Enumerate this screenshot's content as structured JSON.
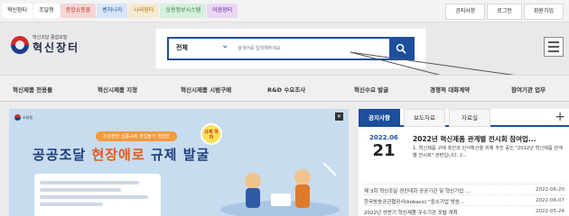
{
  "top_links": [
    {
      "label": "혁신장터",
      "bg": "#ffffff",
      "fg": "#222222"
    },
    {
      "label": "조달청",
      "bg": "#ffffff",
      "fg": "#222222"
    },
    {
      "label": "종합쇼핑몰",
      "bg": "#f4d6d6",
      "fg": "#c0392b"
    },
    {
      "label": "벤처나라",
      "bg": "#d9e6f6",
      "fg": "#1c4f9c"
    },
    {
      "label": "나라장터",
      "bg": "#f5ead3",
      "fg": "#b36b00"
    },
    {
      "label": "상용정보시스템",
      "bg": "#d7efdd",
      "fg": "#2e7d32"
    },
    {
      "label": "이음장터",
      "bg": "#e8d9f3",
      "fg": "#6a1b9a"
    }
  ],
  "utility": {
    "notice": "공지사항",
    "login": "로그인",
    "signup": "회원가입"
  },
  "logo": {
    "subtitle": "혁신조달 종합포털",
    "title": "혁신장터"
  },
  "search": {
    "category": "전체",
    "placeholder": "검색어를 입력해주세요"
  },
  "nav": [
    "혁신제품 전용몰",
    "혁신시제품 지정",
    "혁신시제품 시범구매",
    "R&D 수요조사",
    "혁신수요 발굴",
    "경쟁적 대화계약",
    "참여기관 업무"
  ],
  "banner": {
    "logo_text": "조달청",
    "pill": "조달현장 납품규제 영업불가 경험한",
    "title_main": "공공조달",
    "title_accent": "현장애로",
    "title_rest": "규제 발굴",
    "badge": "규제 혁파"
  },
  "tabs": [
    "공지사항",
    "보도자료",
    "자료실"
  ],
  "tabs_active_index": 0,
  "feature": {
    "year_month": "2022.06",
    "day": "21",
    "title": "2022년 혁신제품 관계별 전시회 참여업...",
    "desc": "1. 혁신제품 구매 촉진과 인식확산을 위해 추진 중인 \"2022년 혁신제품 관계별 전시회\" 관련입니다. 2..."
  },
  "news": [
    {
      "title": "제 3회 혁신조달 경진대회 공공기관 및 혁신기업 ...",
      "date": "2022-06-20"
    },
    {
      "title": "한국방송공관협공사(kobaco) \"중소기업 방송...",
      "date": "2022-06-07"
    },
    {
      "title": "2022년 상반기 혁신제품 우수기관 포탈 개최",
      "date": "2022-05-24"
    }
  ],
  "colors": {
    "brand": "#1c4f9c",
    "accent": "#e05a1d"
  }
}
